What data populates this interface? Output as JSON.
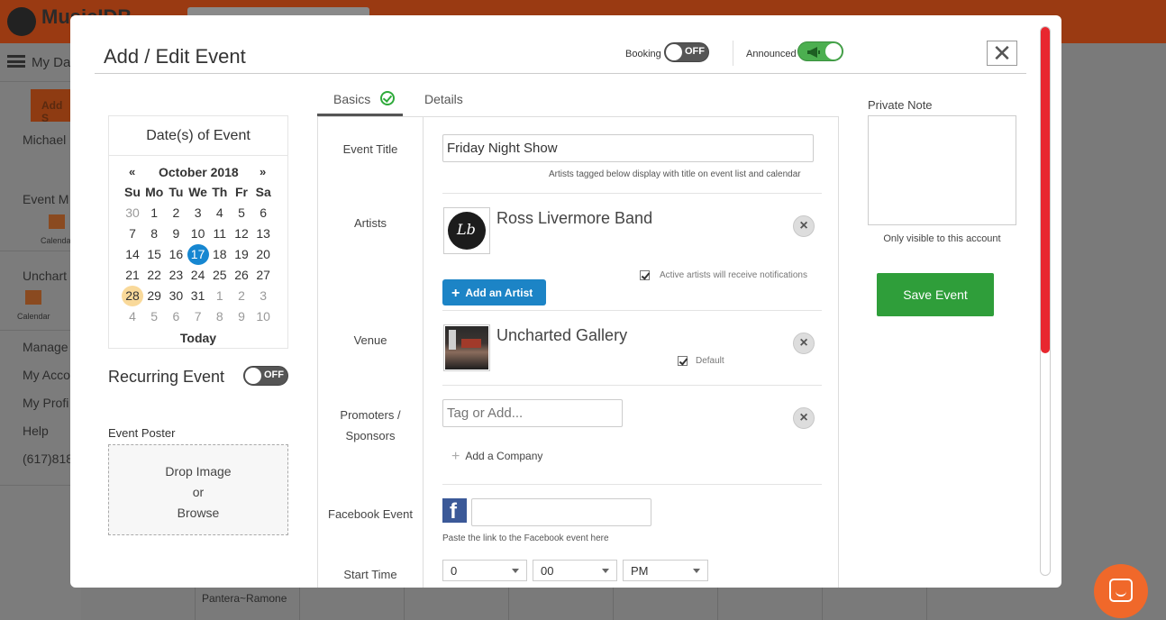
{
  "background": {
    "logo_text": "MusicIDB",
    "dashboard_label": "My Da",
    "add_label": "Add S",
    "sidebar": [
      "Michael",
      "Event M",
      "Calendar",
      "Unchart",
      "Calendar",
      "Manage",
      "My Acco",
      "My Profi",
      "Help",
      "(617)818"
    ],
    "grid_event": "Pantera~Ramone"
  },
  "modal": {
    "title": "Add / Edit Event",
    "close_glyph": "✕",
    "booking": {
      "label": "Booking",
      "state": "OFF"
    },
    "announced": {
      "label": "Announced",
      "state": "on"
    }
  },
  "calendar": {
    "header": "Date(s) of Event",
    "prev": "«",
    "next": "»",
    "month": "October 2018",
    "weekdays": [
      "Su",
      "Mo",
      "Tu",
      "We",
      "Th",
      "Fr",
      "Sa"
    ],
    "weeks": [
      [
        "30",
        "1",
        "2",
        "3",
        "4",
        "5",
        "6"
      ],
      [
        "7",
        "8",
        "9",
        "10",
        "11",
        "12",
        "13"
      ],
      [
        "14",
        "15",
        "16",
        "17",
        "18",
        "19",
        "20"
      ],
      [
        "21",
        "22",
        "23",
        "24",
        "25",
        "26",
        "27"
      ],
      [
        "28",
        "29",
        "30",
        "31",
        "1",
        "2",
        "3"
      ],
      [
        "4",
        "5",
        "6",
        "7",
        "8",
        "9",
        "10"
      ]
    ],
    "selected": "17",
    "today_cell": "28",
    "today_label": "Today"
  },
  "recurring": {
    "label": "Recurring Event",
    "state": "OFF"
  },
  "poster": {
    "label": "Event Poster",
    "line1": "Drop Image",
    "line2": "or",
    "line3": "Browse"
  },
  "tabs": {
    "basics": "Basics",
    "details": "Details"
  },
  "form": {
    "title_label": "Event Title",
    "title_value": "Friday Night Show",
    "title_hint": "Artists tagged below display with title on event list and calendar",
    "artists_label": "Artists",
    "artist_name": "Ross Livermore Band",
    "add_artist": "Add an Artist",
    "notify_hint": "Active artists will receive notifications",
    "venue_label": "Venue",
    "venue_name": "Uncharted Gallery",
    "venue_default": "Default",
    "promoters_label_1": "Promoters /",
    "promoters_label_2": "Sponsors",
    "promoters_placeholder": "Tag or Add...",
    "add_company": "Add a Company",
    "facebook_label": "Facebook Event",
    "facebook_value": "",
    "facebook_hint": "Paste the link to the Facebook event here",
    "start_label": "Start Time",
    "start_hour": "0",
    "start_minute": "00",
    "start_ampm": "PM"
  },
  "note": {
    "label": "Private Note",
    "value": "",
    "hint": "Only visible to this account"
  },
  "save_label": "Save Event",
  "colors": {
    "accent_blue": "#1c84c6",
    "save_green": "#2f9e3a",
    "toggle_green": "#4caf50",
    "scroll_red": "#e8272f",
    "topbar_orange": "#9a3a12",
    "fab_orange": "#f0682a"
  }
}
